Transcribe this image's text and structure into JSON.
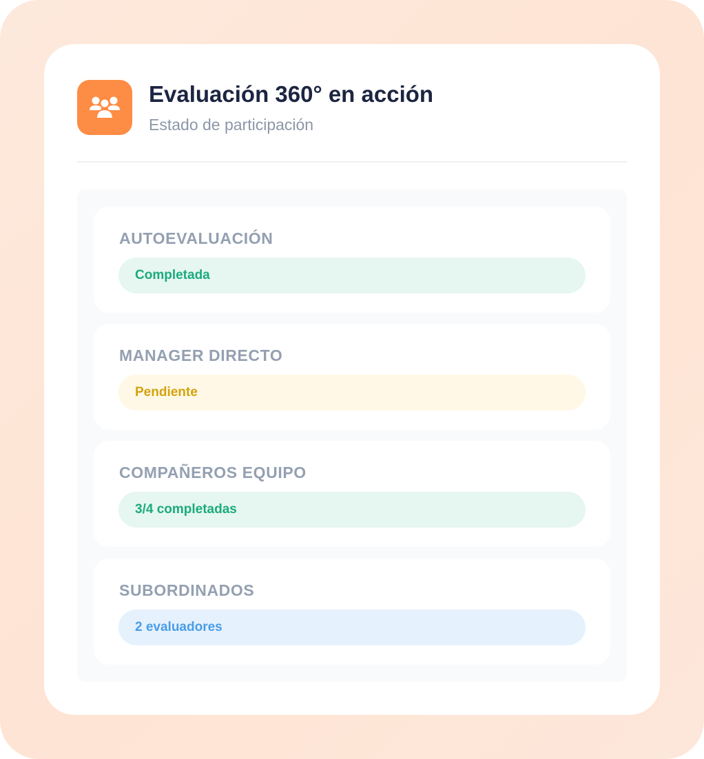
{
  "header": {
    "title": "Evaluación 360° en acción",
    "subtitle": "Estado de participación",
    "icon": "users-group-icon",
    "icon_color": "#fd8c45"
  },
  "items": [
    {
      "label": "AUTOEVALUACIÓN",
      "status": "Completada",
      "status_type": "success"
    },
    {
      "label": "MANAGER DIRECTO",
      "status": "Pendiente",
      "status_type": "pending"
    },
    {
      "label": "COMPAÑEROS EQUIPO",
      "status": "3/4 completadas",
      "status_type": "success"
    },
    {
      "label": "SUBORDINADOS",
      "status": "2 evaluadores",
      "status_type": "info"
    }
  ],
  "colors": {
    "success_text": "#1bab7d",
    "success_bg": "#e6f6f0",
    "pending_text": "#d3a30f",
    "pending_bg": "#fff8e6",
    "info_text": "#4a9de6",
    "info_bg": "#e5f1fd"
  }
}
